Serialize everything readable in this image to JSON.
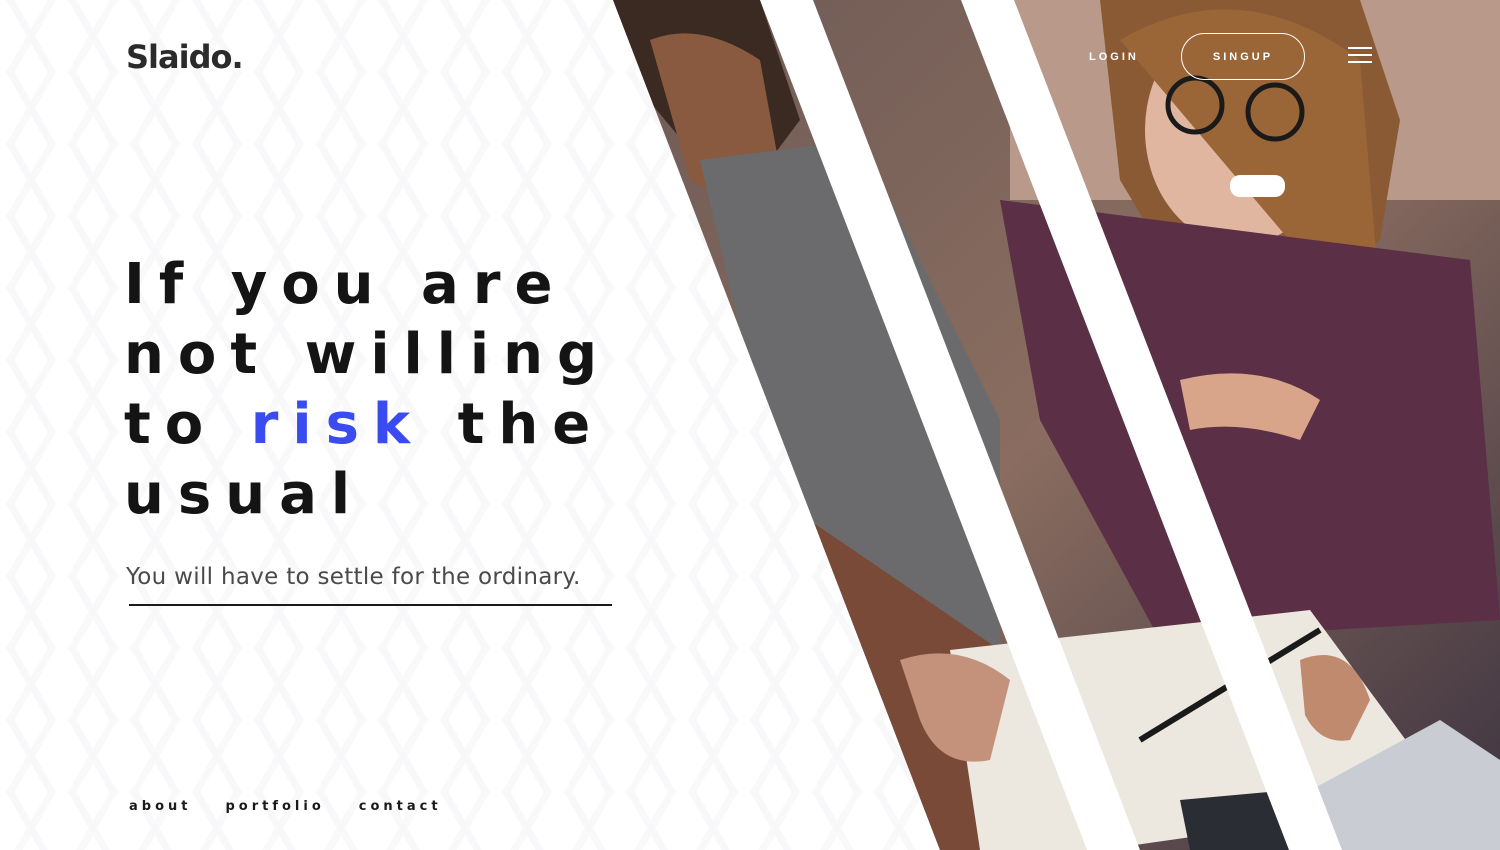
{
  "brand": {
    "logo": "Slaido."
  },
  "header": {
    "login_label": "LOGIN",
    "signup_label": "SINGUP",
    "menu_icon": "hamburger-menu-icon"
  },
  "hero": {
    "line1": "If you are",
    "line2": "not willing",
    "line3_before": "to ",
    "line3_accent": "risk",
    "line3_after": " the",
    "line4": "usual",
    "subline": "You will have to settle for the ordinary."
  },
  "footer_nav": {
    "about": "about",
    "portfolio": "portfolio",
    "contact": "contact"
  },
  "colors": {
    "accent": "#3a4cf0",
    "text": "#141414",
    "background": "#ffffff"
  }
}
